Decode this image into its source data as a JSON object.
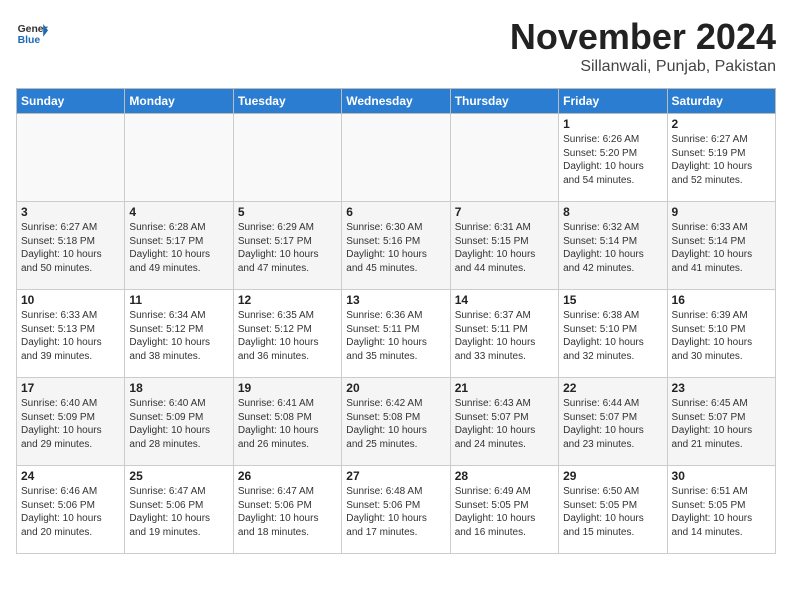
{
  "header": {
    "logo_general": "General",
    "logo_blue": "Blue",
    "month_title": "November 2024",
    "location": "Sillanwali, Punjab, Pakistan"
  },
  "weekdays": [
    "Sunday",
    "Monday",
    "Tuesday",
    "Wednesday",
    "Thursday",
    "Friday",
    "Saturday"
  ],
  "weeks": [
    [
      {
        "day": "",
        "info": ""
      },
      {
        "day": "",
        "info": ""
      },
      {
        "day": "",
        "info": ""
      },
      {
        "day": "",
        "info": ""
      },
      {
        "day": "",
        "info": ""
      },
      {
        "day": "1",
        "info": "Sunrise: 6:26 AM\nSunset: 5:20 PM\nDaylight: 10 hours\nand 54 minutes."
      },
      {
        "day": "2",
        "info": "Sunrise: 6:27 AM\nSunset: 5:19 PM\nDaylight: 10 hours\nand 52 minutes."
      }
    ],
    [
      {
        "day": "3",
        "info": "Sunrise: 6:27 AM\nSunset: 5:18 PM\nDaylight: 10 hours\nand 50 minutes."
      },
      {
        "day": "4",
        "info": "Sunrise: 6:28 AM\nSunset: 5:17 PM\nDaylight: 10 hours\nand 49 minutes."
      },
      {
        "day": "5",
        "info": "Sunrise: 6:29 AM\nSunset: 5:17 PM\nDaylight: 10 hours\nand 47 minutes."
      },
      {
        "day": "6",
        "info": "Sunrise: 6:30 AM\nSunset: 5:16 PM\nDaylight: 10 hours\nand 45 minutes."
      },
      {
        "day": "7",
        "info": "Sunrise: 6:31 AM\nSunset: 5:15 PM\nDaylight: 10 hours\nand 44 minutes."
      },
      {
        "day": "8",
        "info": "Sunrise: 6:32 AM\nSunset: 5:14 PM\nDaylight: 10 hours\nand 42 minutes."
      },
      {
        "day": "9",
        "info": "Sunrise: 6:33 AM\nSunset: 5:14 PM\nDaylight: 10 hours\nand 41 minutes."
      }
    ],
    [
      {
        "day": "10",
        "info": "Sunrise: 6:33 AM\nSunset: 5:13 PM\nDaylight: 10 hours\nand 39 minutes."
      },
      {
        "day": "11",
        "info": "Sunrise: 6:34 AM\nSunset: 5:12 PM\nDaylight: 10 hours\nand 38 minutes."
      },
      {
        "day": "12",
        "info": "Sunrise: 6:35 AM\nSunset: 5:12 PM\nDaylight: 10 hours\nand 36 minutes."
      },
      {
        "day": "13",
        "info": "Sunrise: 6:36 AM\nSunset: 5:11 PM\nDaylight: 10 hours\nand 35 minutes."
      },
      {
        "day": "14",
        "info": "Sunrise: 6:37 AM\nSunset: 5:11 PM\nDaylight: 10 hours\nand 33 minutes."
      },
      {
        "day": "15",
        "info": "Sunrise: 6:38 AM\nSunset: 5:10 PM\nDaylight: 10 hours\nand 32 minutes."
      },
      {
        "day": "16",
        "info": "Sunrise: 6:39 AM\nSunset: 5:10 PM\nDaylight: 10 hours\nand 30 minutes."
      }
    ],
    [
      {
        "day": "17",
        "info": "Sunrise: 6:40 AM\nSunset: 5:09 PM\nDaylight: 10 hours\nand 29 minutes."
      },
      {
        "day": "18",
        "info": "Sunrise: 6:40 AM\nSunset: 5:09 PM\nDaylight: 10 hours\nand 28 minutes."
      },
      {
        "day": "19",
        "info": "Sunrise: 6:41 AM\nSunset: 5:08 PM\nDaylight: 10 hours\nand 26 minutes."
      },
      {
        "day": "20",
        "info": "Sunrise: 6:42 AM\nSunset: 5:08 PM\nDaylight: 10 hours\nand 25 minutes."
      },
      {
        "day": "21",
        "info": "Sunrise: 6:43 AM\nSunset: 5:07 PM\nDaylight: 10 hours\nand 24 minutes."
      },
      {
        "day": "22",
        "info": "Sunrise: 6:44 AM\nSunset: 5:07 PM\nDaylight: 10 hours\nand 23 minutes."
      },
      {
        "day": "23",
        "info": "Sunrise: 6:45 AM\nSunset: 5:07 PM\nDaylight: 10 hours\nand 21 minutes."
      }
    ],
    [
      {
        "day": "24",
        "info": "Sunrise: 6:46 AM\nSunset: 5:06 PM\nDaylight: 10 hours\nand 20 minutes."
      },
      {
        "day": "25",
        "info": "Sunrise: 6:47 AM\nSunset: 5:06 PM\nDaylight: 10 hours\nand 19 minutes."
      },
      {
        "day": "26",
        "info": "Sunrise: 6:47 AM\nSunset: 5:06 PM\nDaylight: 10 hours\nand 18 minutes."
      },
      {
        "day": "27",
        "info": "Sunrise: 6:48 AM\nSunset: 5:06 PM\nDaylight: 10 hours\nand 17 minutes."
      },
      {
        "day": "28",
        "info": "Sunrise: 6:49 AM\nSunset: 5:05 PM\nDaylight: 10 hours\nand 16 minutes."
      },
      {
        "day": "29",
        "info": "Sunrise: 6:50 AM\nSunset: 5:05 PM\nDaylight: 10 hours\nand 15 minutes."
      },
      {
        "day": "30",
        "info": "Sunrise: 6:51 AM\nSunset: 5:05 PM\nDaylight: 10 hours\nand 14 minutes."
      }
    ]
  ]
}
